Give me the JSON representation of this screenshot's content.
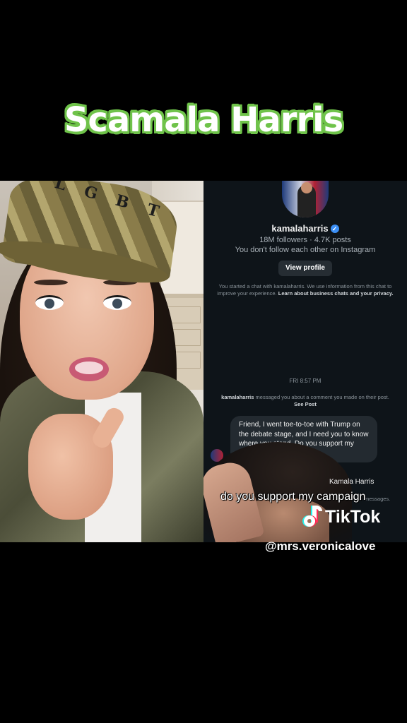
{
  "title": "Scamala Harris",
  "left_video": {
    "cap_letters": "L G B T"
  },
  "chat": {
    "username": "kamalaharris",
    "stats": "18M followers · 4.7K posts",
    "follow_note": "You don't follow each other on Instagram",
    "view_profile_label": "View profile",
    "started_text": "You started a chat with kamalaharris. We use information from this chat to improve your experience.",
    "started_link": "Learn about business chats and your privacy.",
    "timestamp": "FRI 8:57 PM",
    "msg_note_user": "kamalaharris",
    "msg_note_text": "messaged you about a comment you made on their post.",
    "msg_note_link": "See Post",
    "bubble_text": "Friend, I went toe-to-toe with Trump on the debate stage, and I need you to know where you stand. Do you support my campai",
    "sender_fragment": "Kamala Harris",
    "messages_fragment": "messages."
  },
  "caption": "do you support my campaign",
  "watermark": {
    "brand": "TikTok",
    "handle": "@mrs.veronicalove"
  },
  "colors": {
    "title_outline": "#6fc34a",
    "chat_bg": "#0e1419",
    "verified": "#3b8ff5"
  }
}
